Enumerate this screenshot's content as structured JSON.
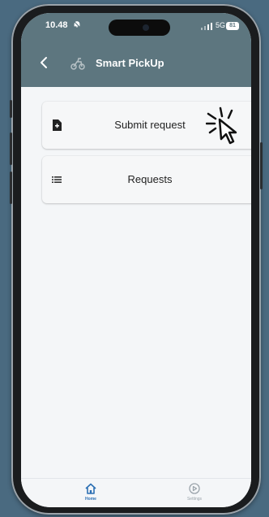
{
  "status_bar": {
    "time": "10.48",
    "time_icon": "silent-bell-icon",
    "network": "5G",
    "battery": "81"
  },
  "app_bar": {
    "title": "Smart PickUp",
    "back_icon": "chevron-left-icon",
    "logo_icon": "scooter-logo-icon"
  },
  "menu": {
    "items": [
      {
        "label": "Submit request",
        "icon": "document-icon"
      },
      {
        "label": "Requests",
        "icon": "list-icon"
      }
    ]
  },
  "bottom_nav": {
    "items": [
      {
        "label": "Home",
        "icon": "home-icon",
        "active": true
      },
      {
        "label": "Settings",
        "icon": "settings-icon",
        "active": false
      }
    ]
  },
  "colors": {
    "header": "#5d767f",
    "background": "#f4f6f8",
    "active_tab": "#2b6fb3",
    "frame_bg": "#4a6a80"
  }
}
